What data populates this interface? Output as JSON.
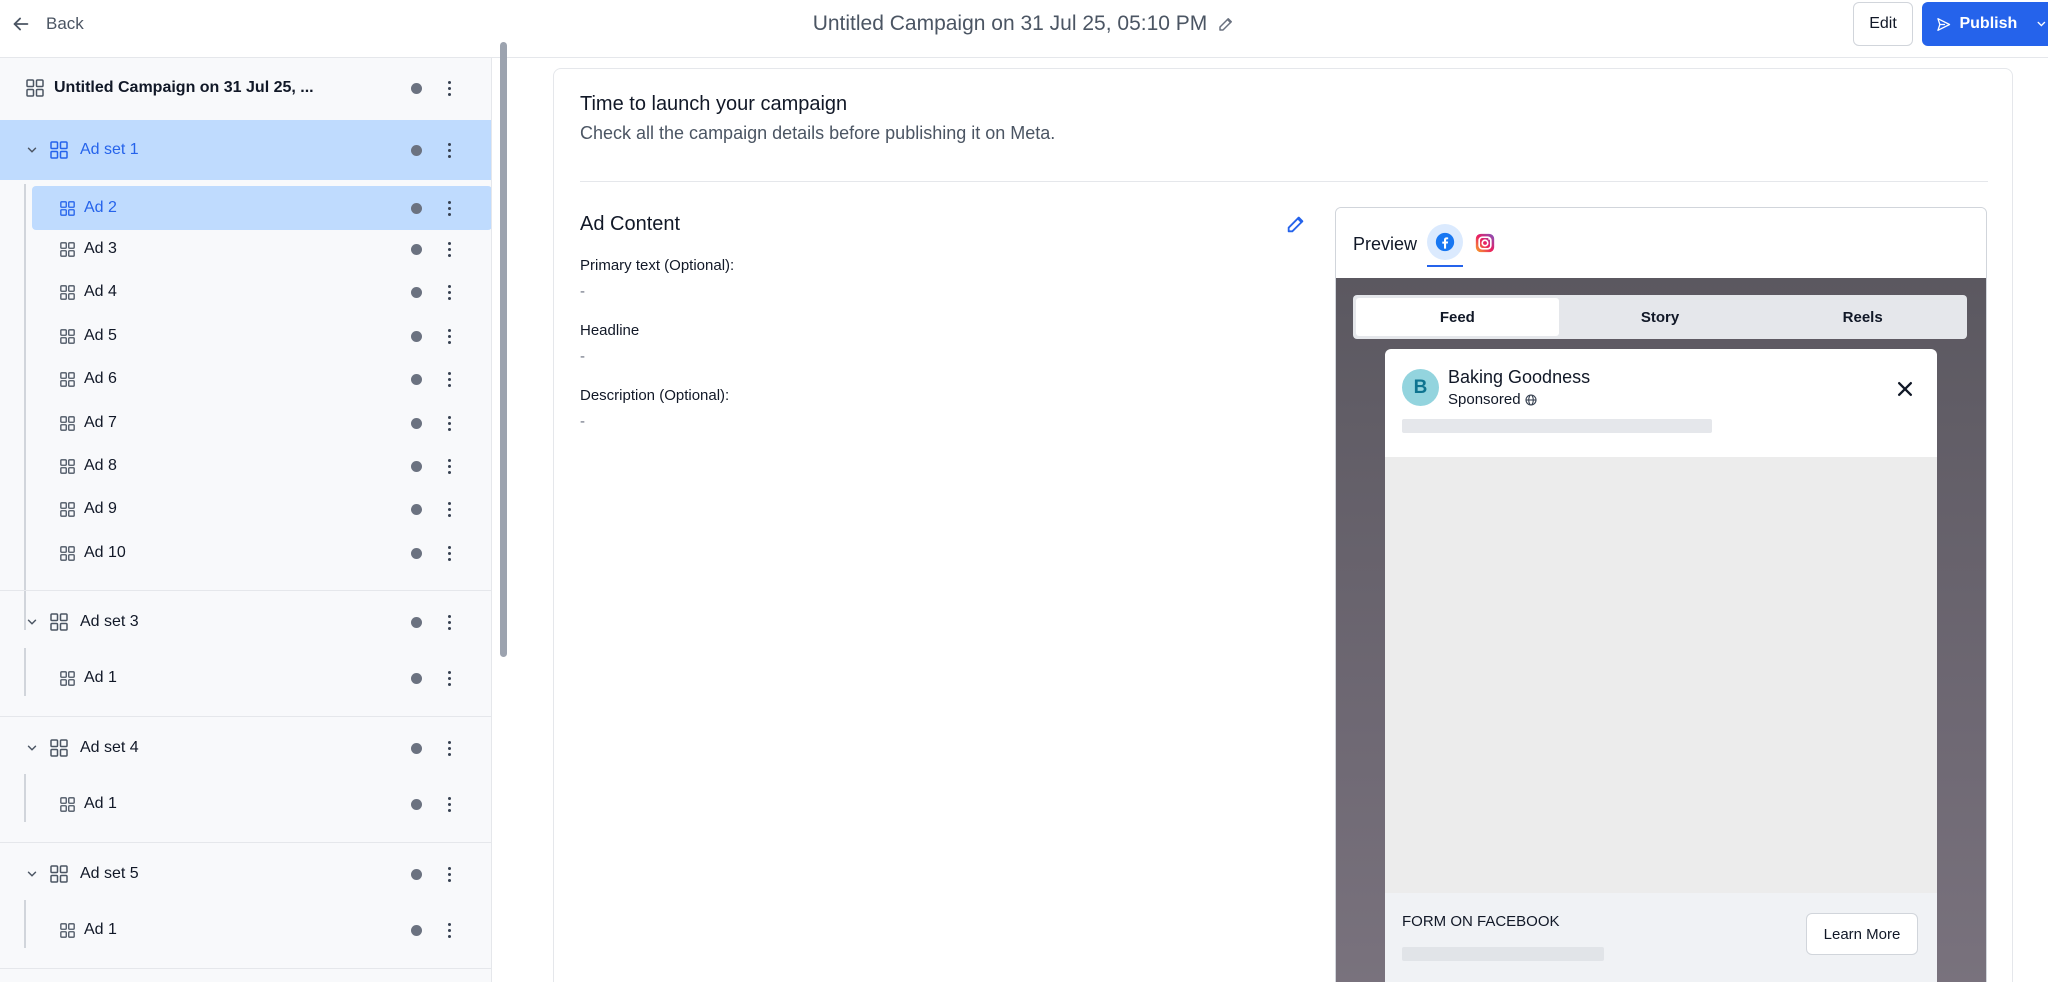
{
  "topbar": {
    "back_label": "Back",
    "campaign_title": "Untitled Campaign on 31 Jul 25, 05:10 PM",
    "edit_label": "Edit",
    "publish_label": "Publish"
  },
  "sidebar": {
    "campaign_label": "Untitled Campaign on 31 Jul 25, ...",
    "adsets": [
      {
        "label": "Ad set 1",
        "selected": true,
        "ads": [
          "Ad 2",
          "Ad 3",
          "Ad 4",
          "Ad 5",
          "Ad 6",
          "Ad 7",
          "Ad 8",
          "Ad 9",
          "Ad 10"
        ],
        "selected_ad": "Ad 2"
      },
      {
        "label": "Ad set 3",
        "ads": [
          "Ad 1"
        ]
      },
      {
        "label": "Ad set 4",
        "ads": [
          "Ad 1"
        ]
      },
      {
        "label": "Ad set 5",
        "ads": [
          "Ad 1"
        ]
      }
    ]
  },
  "main": {
    "title": "Time to launch your campaign",
    "subtitle": "Check all the campaign details before publishing it on Meta.",
    "ad_content": {
      "title": "Ad Content",
      "fields": [
        {
          "label": "Primary text (Optional):",
          "value": "-"
        },
        {
          "label": "Headline",
          "value": "-"
        },
        {
          "label": "Description (Optional):",
          "value": "-"
        }
      ]
    }
  },
  "preview": {
    "title": "Preview",
    "platforms": [
      "facebook-icon",
      "instagram-icon"
    ],
    "active_platform": "facebook",
    "placements": [
      "Feed",
      "Story",
      "Reels"
    ],
    "active_placement": "Feed",
    "post": {
      "avatar_letter": "B",
      "brand_name": "Baking Goodness",
      "sponsored_label": "Sponsored",
      "form_label": "FORM ON FACEBOOK",
      "cta_label": "Learn More"
    }
  },
  "colors": {
    "accent": "#2563eb",
    "selected_bg": "#bfdbfe",
    "avatar_bg": "#93d4de"
  }
}
